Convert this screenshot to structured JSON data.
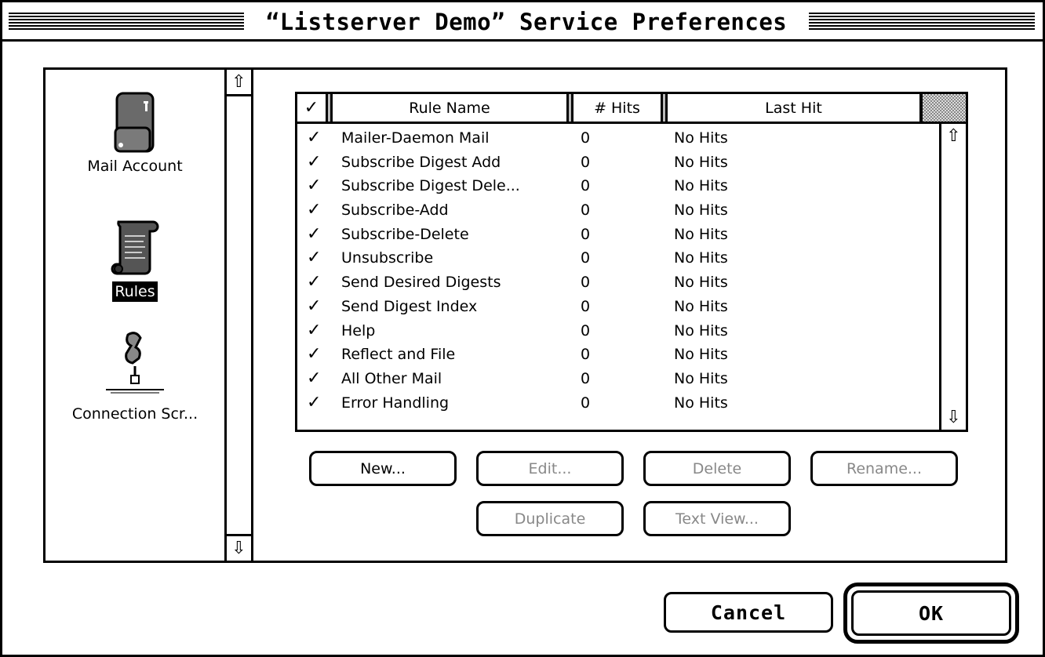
{
  "window": {
    "title": "“Listserver Demo” Service Preferences"
  },
  "sidebar": {
    "items": [
      {
        "label": "Mail Account",
        "icon": "mail-account-icon",
        "selected": false
      },
      {
        "label": "Rules",
        "icon": "rules-scroll-icon",
        "selected": true
      },
      {
        "label": "Connection Scr...",
        "icon": "connection-script-icon",
        "selected": false
      }
    ]
  },
  "table": {
    "headers": {
      "check": "✓",
      "name": "Rule Name",
      "hits": "# Hits",
      "last": "Last Hit"
    },
    "rows": [
      {
        "check": "✓",
        "name": "Mailer-Daemon Mail",
        "hits": "0",
        "last": "No Hits"
      },
      {
        "check": "✓",
        "name": "Subscribe Digest Add",
        "hits": "0",
        "last": "No Hits"
      },
      {
        "check": "✓",
        "name": "Subscribe Digest Dele...",
        "hits": "0",
        "last": "No Hits"
      },
      {
        "check": "✓",
        "name": "Subscribe-Add",
        "hits": "0",
        "last": "No Hits"
      },
      {
        "check": "✓",
        "name": "Subscribe-Delete",
        "hits": "0",
        "last": "No Hits"
      },
      {
        "check": "✓",
        "name": "Unsubscribe",
        "hits": "0",
        "last": "No Hits"
      },
      {
        "check": "✓",
        "name": "Send Desired Digests",
        "hits": "0",
        "last": "No Hits"
      },
      {
        "check": "✓",
        "name": "Send Digest Index",
        "hits": "0",
        "last": "No Hits"
      },
      {
        "check": "✓",
        "name": "Help",
        "hits": "0",
        "last": "No Hits"
      },
      {
        "check": "✓",
        "name": "Reflect and File",
        "hits": "0",
        "last": "No Hits"
      },
      {
        "check": "✓",
        "name": "All Other Mail",
        "hits": "0",
        "last": "No Hits"
      },
      {
        "check": "✓",
        "name": "Error Handling",
        "hits": "0",
        "last": "No Hits"
      }
    ]
  },
  "buttons": {
    "new": "New...",
    "edit": "Edit...",
    "delete": "Delete",
    "rename": "Rename...",
    "duplicate": "Duplicate",
    "text_view": "Text View...",
    "cancel": "Cancel",
    "ok": "OK"
  },
  "scroll": {
    "up_arrow": "⇧",
    "down_arrow": "⇩"
  }
}
